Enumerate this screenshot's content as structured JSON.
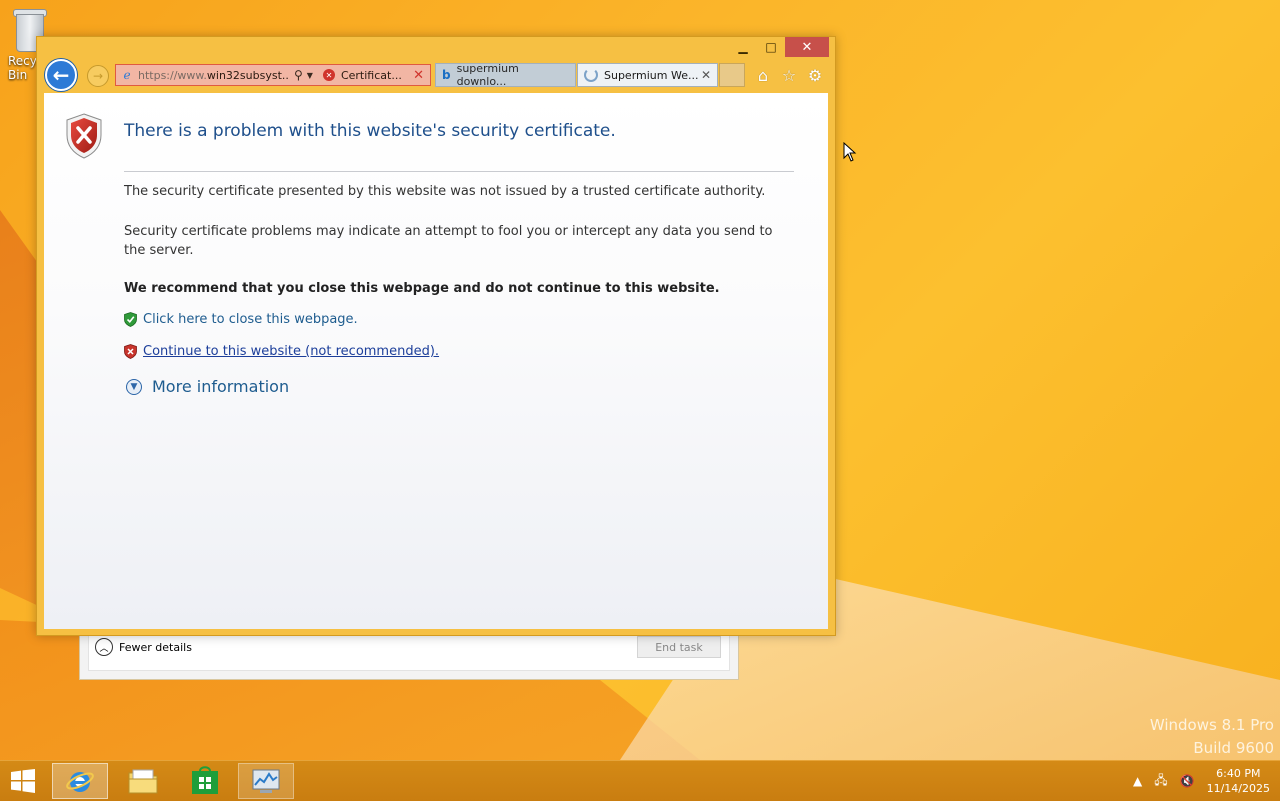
{
  "desktop": {
    "recycle_bin_label": "Recycle Bin",
    "watermark": {
      "line1": "Windows 8.1 Pro",
      "line2": "Build 9600"
    }
  },
  "task_manager": {
    "fewer_details": "Fewer details",
    "end_task": "End task"
  },
  "ie": {
    "address": {
      "url_prefix": "https://www.",
      "url_domain": "win32subsyst...",
      "cert_label": "Certificat..."
    },
    "tabs": [
      {
        "label": "supermium downlo...",
        "icon": "bing-icon"
      },
      {
        "label": "Supermium We...",
        "icon": "loading-spinner-icon"
      }
    ],
    "error": {
      "title": "There is a problem with this website's security certificate.",
      "p1": "The security certificate presented by this website was not issued by a trusted certificate authority.",
      "p2": "Security certificate problems may indicate an attempt to fool you or intercept any data you send to the server.",
      "recommend": "We recommend that you close this webpage and do not continue to this website.",
      "close_link": "Click here to close this webpage.",
      "continue_link": "Continue to this website (not recommended).",
      "more_info": "More information"
    }
  },
  "taskbar": {
    "apps": [
      "internet-explorer",
      "file-explorer",
      "store",
      "task-manager"
    ],
    "clock": {
      "time": "6:40 PM",
      "date": "11/14/2025"
    }
  },
  "colors": {
    "title_blue": "#1e4f8b",
    "link_blue": "#1e5c8f",
    "close_red": "#c7504a",
    "accent_orange": "#f7a21b"
  }
}
